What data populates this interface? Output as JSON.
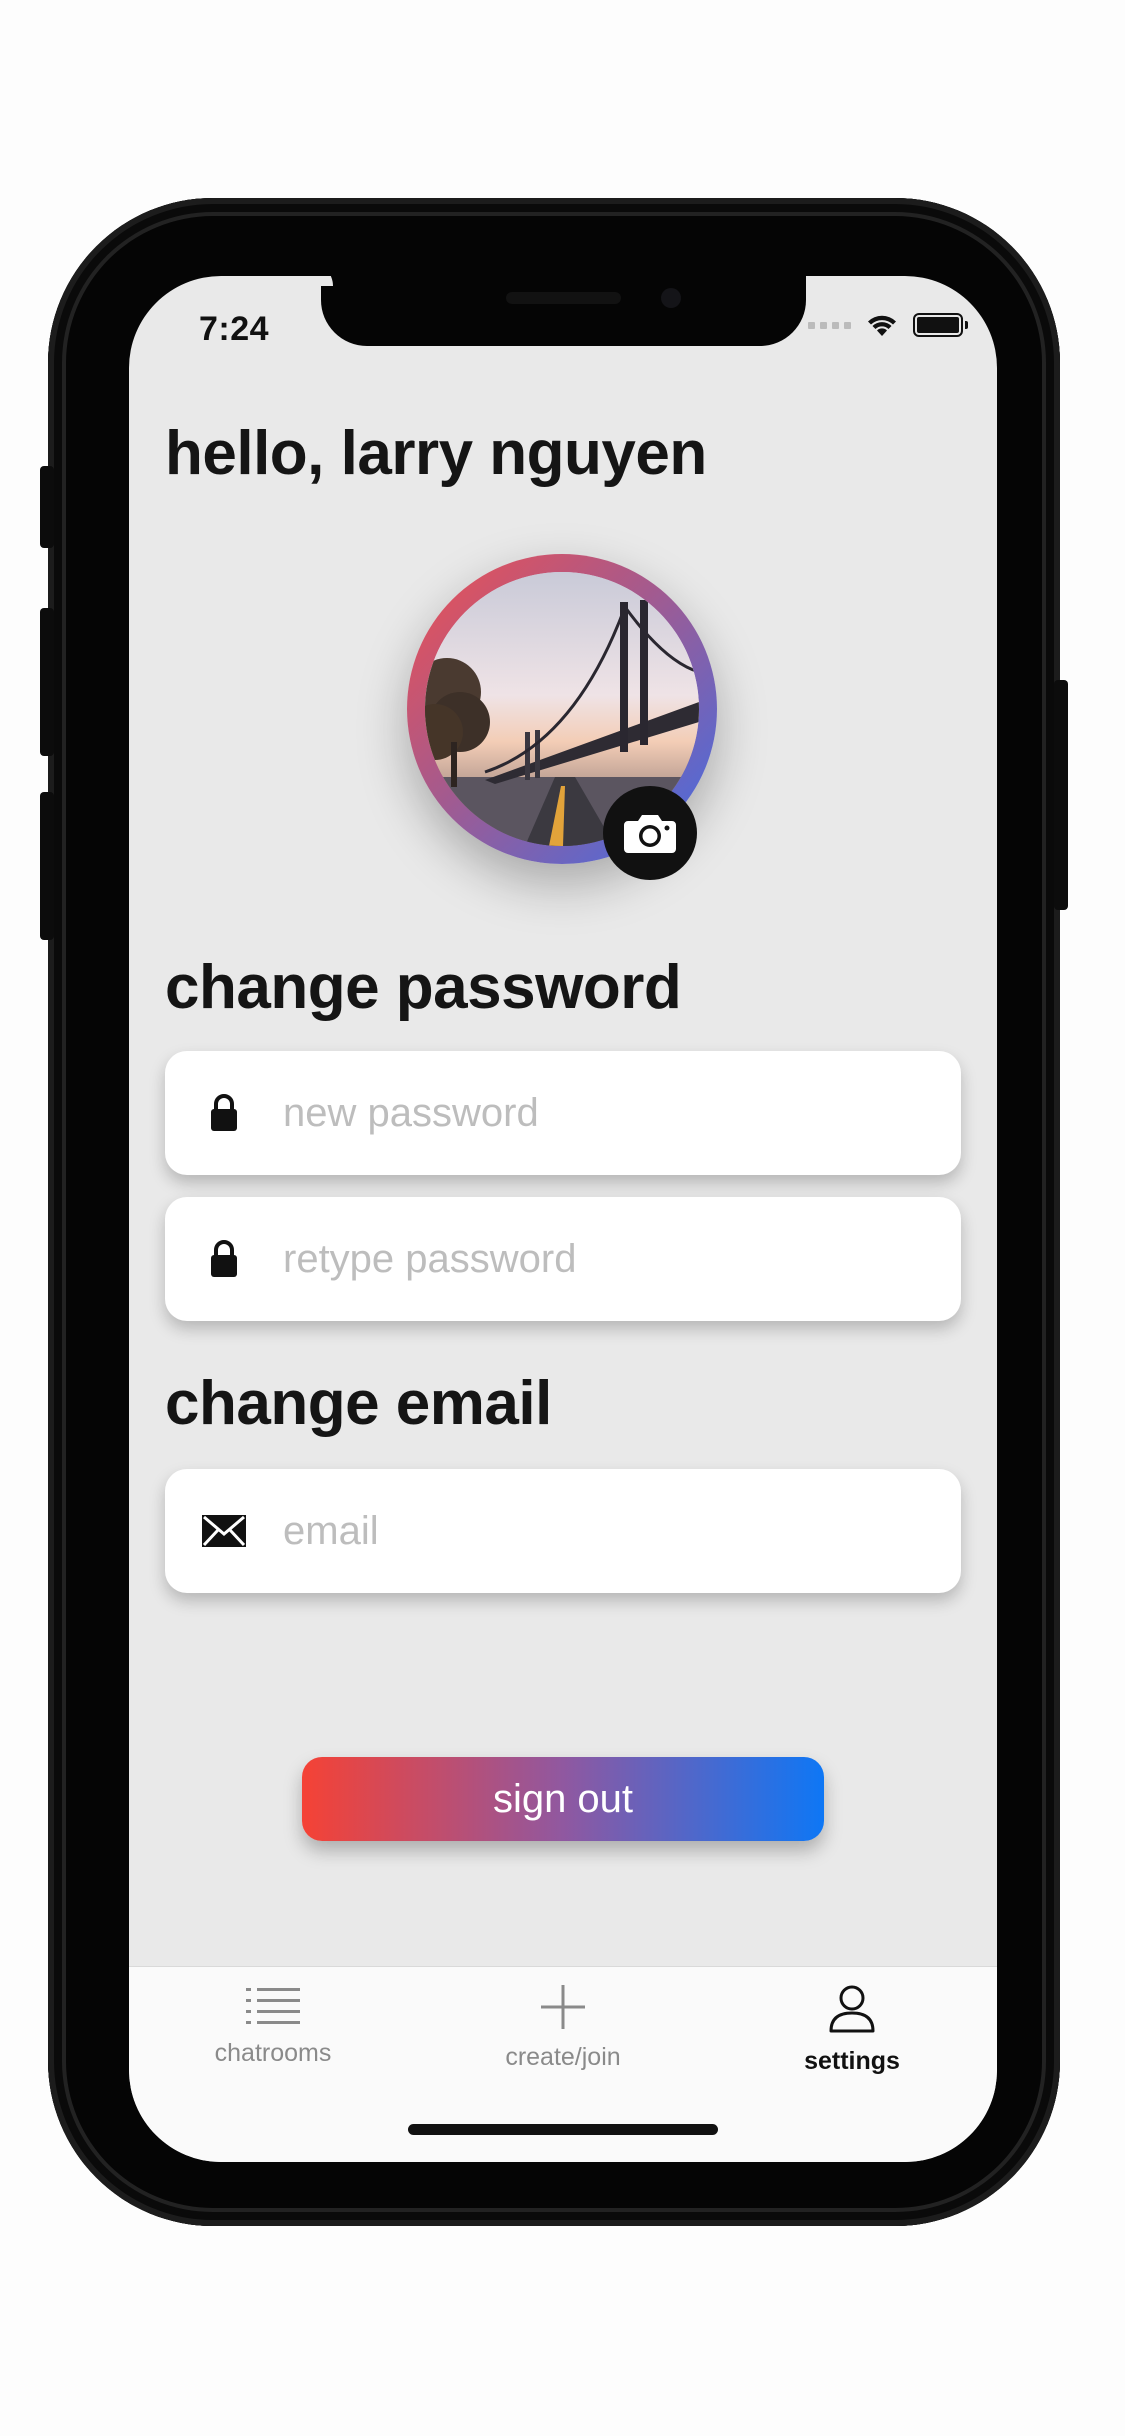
{
  "status_bar": {
    "time": "7:24",
    "wifi_icon": "wifi-icon",
    "battery_icon": "battery-icon"
  },
  "header": {
    "greeting": "hello, larry nguyen"
  },
  "profile": {
    "avatar_description_icon": "profile-photo",
    "camera_icon": "camera-icon",
    "ring_colors": [
      "#f05050",
      "#3d6ee8"
    ]
  },
  "password_section": {
    "title": "change password",
    "new_password_placeholder": "new password",
    "retype_password_placeholder": "retype password",
    "field_icon": "lock-icon"
  },
  "email_section": {
    "title": "change email",
    "email_placeholder": "email",
    "field_icon": "envelope-icon"
  },
  "actions": {
    "sign_out_label": "sign out",
    "gradient_start": "#f54235",
    "gradient_end": "#0e77f5"
  },
  "tabbar": {
    "items": [
      {
        "label": "chatrooms",
        "icon": "list-icon",
        "active": false
      },
      {
        "label": "create/join",
        "icon": "plus-icon",
        "active": false
      },
      {
        "label": "settings",
        "icon": "person-icon",
        "active": true
      }
    ]
  }
}
